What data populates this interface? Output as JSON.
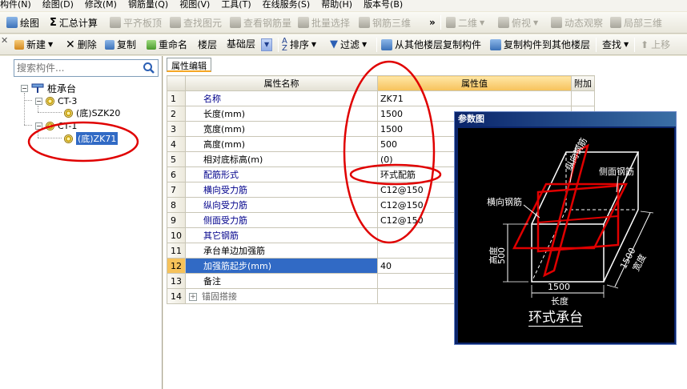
{
  "menu": [
    "构件(N)",
    "绘图(D)",
    "修改(M)",
    "钢筋量(Q)",
    "视图(V)",
    "工具(T)",
    "在线服务(S)",
    "帮助(H)",
    "版本号(B)"
  ],
  "toolbar1": {
    "draw": "绘图",
    "sum_calc": "汇总计算",
    "level_slab": "平齐板顶",
    "find_elem": "查找图元",
    "view_rebar": "查看钢筋量",
    "batch_select": "批量选择",
    "rebar_3d": "钢筋三维",
    "view_mode": "二维",
    "top_view": "俯视",
    "dynamic_view": "动态观察",
    "local_3d": "局部三维"
  },
  "toolbar2": {
    "new": "新建",
    "delete": "删除",
    "copy": "复制",
    "rename": "重命名",
    "floor_label": "楼层",
    "floor_value": "基础层",
    "sort": "排序",
    "filter": "过滤",
    "copy_from": "从其他楼层复制构件",
    "copy_to": "复制构件到其他楼层",
    "find": "查找",
    "move_up": "上移"
  },
  "left_panel": {
    "search_placeholder": "搜索构件...",
    "root": "桩承台",
    "nodes": [
      {
        "label": "CT-3",
        "child": "(底)SZK20"
      },
      {
        "label": "CT-1",
        "child": "(底)ZK71"
      }
    ]
  },
  "property_tab": "属性编辑",
  "grid": {
    "headers": {
      "name": "属性名称",
      "value": "属性值",
      "extra": "附加"
    },
    "rows": [
      {
        "no": "1",
        "name": "名称",
        "value": "ZK71"
      },
      {
        "no": "2",
        "name": "长度(mm)",
        "value": "1500"
      },
      {
        "no": "3",
        "name": "宽度(mm)",
        "value": "1500"
      },
      {
        "no": "4",
        "name": "高度(mm)",
        "value": "500"
      },
      {
        "no": "5",
        "name": "相对底标高(m)",
        "value": "(0)"
      },
      {
        "no": "6",
        "name": "配筋形式",
        "value": "环式配筋"
      },
      {
        "no": "7",
        "name": "横向受力筋",
        "value": "C12@150"
      },
      {
        "no": "8",
        "name": "纵向受力筋",
        "value": "C12@150"
      },
      {
        "no": "9",
        "name": "侧面受力筋",
        "value": "C12@150"
      },
      {
        "no": "10",
        "name": "其它钢筋",
        "value": ""
      },
      {
        "no": "11",
        "name": "承台单边加强筋",
        "value": ""
      },
      {
        "no": "12",
        "name": "加强筋起步(mm)",
        "value": "40"
      },
      {
        "no": "13",
        "name": "备注",
        "value": ""
      },
      {
        "no": "14",
        "name": "锚固搭接",
        "value": ""
      }
    ]
  },
  "figure": {
    "title": "参数图",
    "labels": {
      "longitudinal": "纵向钢筋",
      "side": "侧面钢筋",
      "transverse": "横向钢筋",
      "height": "高度",
      "height_val": "500",
      "width_val": "1500",
      "width": "宽度",
      "length_val": "1500",
      "length": "长度"
    },
    "caption": "环式承台"
  },
  "colors": {
    "annotation": "#E00000",
    "selection": "#316AC5",
    "header_highlight": "#F6C25A"
  }
}
